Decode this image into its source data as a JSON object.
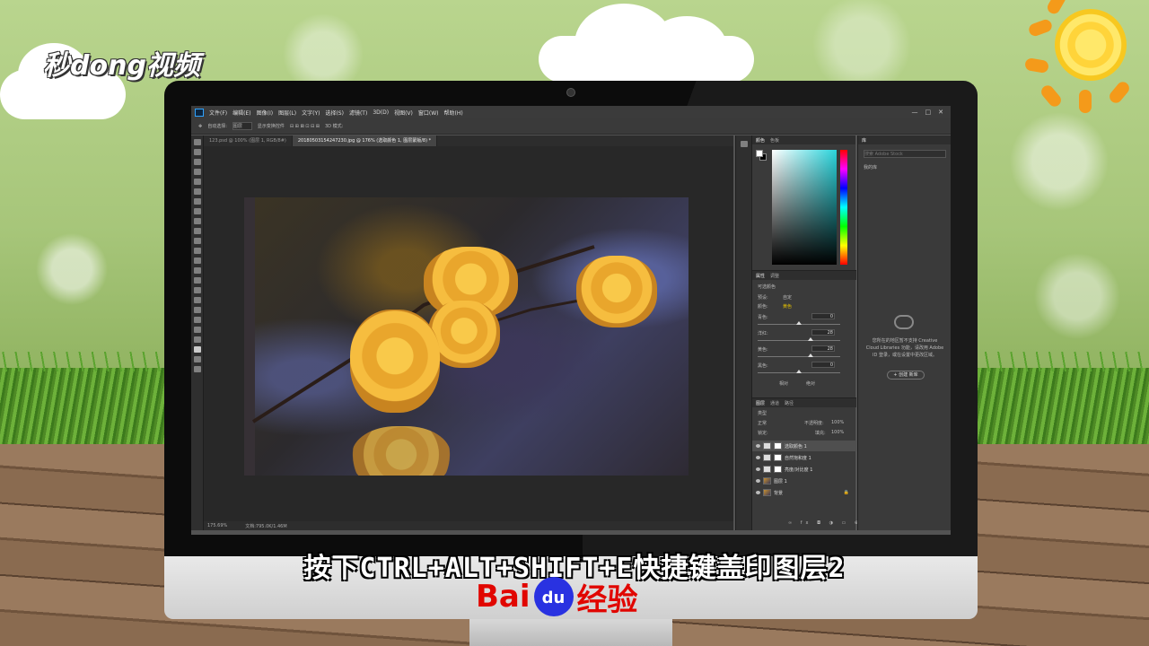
{
  "branding": {
    "video_logo": "秒dong视频",
    "baidu_logo_left": "Bai",
    "baidu_logo_paw": "du",
    "baidu_logo_right": "经验"
  },
  "caption": "按下CTRL+ALT+SHIFT+E快捷键盖印图层2",
  "photoshop": {
    "menu": [
      "文件(F)",
      "编辑(E)",
      "图像(I)",
      "图层(L)",
      "文字(Y)",
      "选择(S)",
      "滤镜(T)",
      "3D(D)",
      "视图(V)",
      "窗口(W)",
      "帮助(H)"
    ],
    "window_controls": [
      "—",
      "□",
      "✕"
    ],
    "options": {
      "auto_select": "自动选择:",
      "auto_select_value": "图层",
      "show_transform": "显示变换控件",
      "mode_3d": "3D 模式:"
    },
    "tabs": [
      {
        "label": "123.psd @ 100% (图层 1, RGB/8#)"
      },
      {
        "label": "20180503154247230.jpg @ 176% (选取颜色 1, 图层蒙版/8) *"
      }
    ],
    "status": {
      "zoom": "175.69%",
      "doc": "文档:795.0K/1.46M"
    },
    "color_panel": {
      "tabs": [
        "颜色",
        "色板"
      ]
    },
    "properties": {
      "tabs": [
        "属性",
        "调整"
      ],
      "title": "可选颜色",
      "preset_label": "预设:",
      "preset_value": "自定",
      "colors_label": "颜色:",
      "colors_value": "黄色",
      "sliders": [
        {
          "label": "青色:",
          "value": "0",
          "unit": "%",
          "fraction": 0.5
        },
        {
          "label": "洋红:",
          "value": "28",
          "unit": "%",
          "fraction": 0.64
        },
        {
          "label": "黄色:",
          "value": "28",
          "unit": "%",
          "fraction": 0.64
        },
        {
          "label": "黑色:",
          "value": "0",
          "unit": "%",
          "fraction": 0.5
        }
      ],
      "method_relative": "相对",
      "method_absolute": "绝对"
    },
    "layers": {
      "tabs": [
        "图层",
        "通道",
        "路径"
      ],
      "kind_label": "类型",
      "blend_mode": "正常",
      "opacity_label": "不透明度:",
      "opacity_value": "100%",
      "lock_label": "锁定:",
      "fill_label": "填充:",
      "fill_value": "100%",
      "items": [
        {
          "name": "选取颜色 1",
          "type": "adjustment",
          "selected": true
        },
        {
          "name": "自然饱和度 1",
          "type": "adjustment",
          "selected": false
        },
        {
          "name": "亮度/对比度 1",
          "type": "adjustment",
          "selected": false
        },
        {
          "name": "图层 1",
          "type": "pixel",
          "selected": false
        },
        {
          "name": "背景",
          "type": "pixel",
          "selected": false
        }
      ]
    },
    "libraries": {
      "tab": "库",
      "search_placeholder": "搜索 Adobe Stock",
      "dropdown": "我的库",
      "message": "您所在的地区暂不支持 Creative Cloud Libraries 功能，请改用 Adobe ID 登录，或在设置中更改区域。",
      "create_button": "+ 创建 新库"
    }
  }
}
